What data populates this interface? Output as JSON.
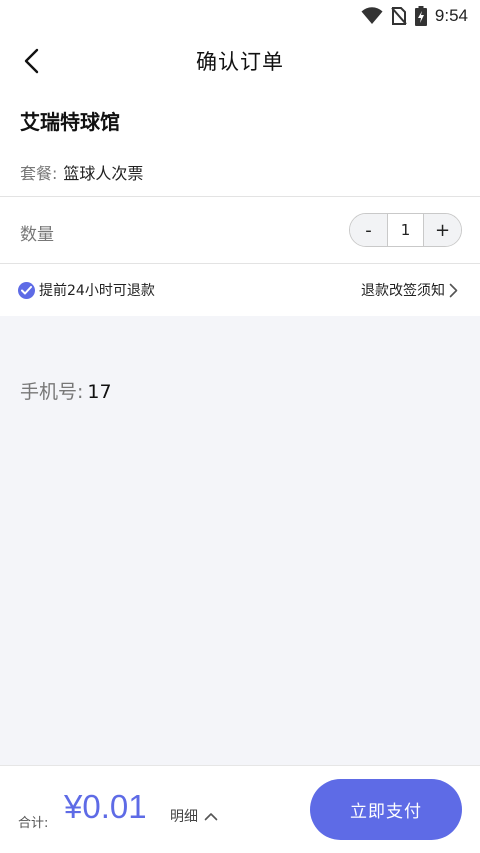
{
  "status_bar": {
    "time": "9:54"
  },
  "header": {
    "title": "确认订单"
  },
  "order": {
    "venue_name": "艾瑞特球馆",
    "package_label": "套餐:",
    "package_value": "篮球人次票",
    "quantity_label": "数量",
    "quantity_minus": "-",
    "quantity_value": "1",
    "quantity_plus": "+",
    "refund_note": "提前24小时可退款",
    "refund_policy_link": "退款改签须知"
  },
  "contact": {
    "phone_label": "手机号:",
    "phone_value": "17"
  },
  "footer": {
    "total_label": "合计:",
    "total_amount": "¥0.01",
    "detail_label": "明细",
    "pay_button": "立即支付"
  },
  "colors": {
    "accent": "#5e6be6",
    "background": "#f4f5f9"
  }
}
